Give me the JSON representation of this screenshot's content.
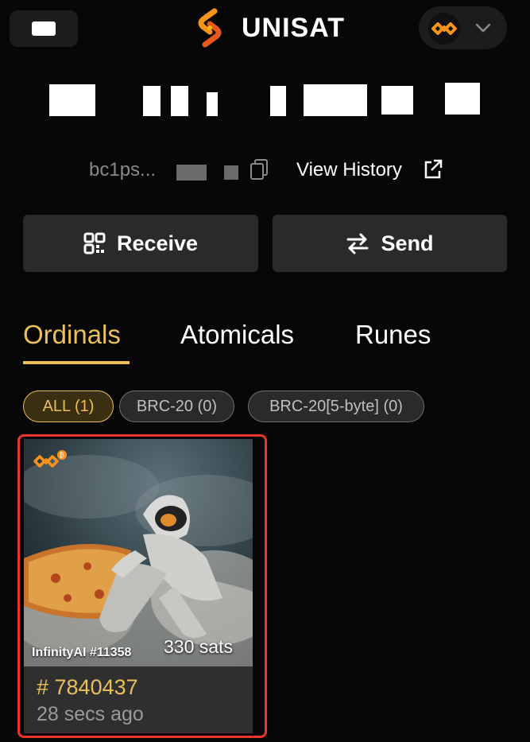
{
  "header": {
    "brand": "UNISAT",
    "menu_icon": "menu-icon",
    "logo_icon": "unisat-logo-icon",
    "account_icon": "chevron-down-icon"
  },
  "balance": {
    "redacted": true
  },
  "address": {
    "short": "bc1ps...",
    "copy_icon": "copy-icon"
  },
  "view_history": {
    "label": "View History",
    "icon": "external-link-icon"
  },
  "actions": {
    "receive_label": "Receive",
    "receive_icon": "qr-code-icon",
    "send_label": "Send",
    "send_icon": "swap-arrows-icon"
  },
  "tabs": [
    {
      "label": "Ordinals",
      "active": true
    },
    {
      "label": "Atomicals",
      "active": false
    },
    {
      "label": "Runes",
      "active": false
    }
  ],
  "filters": [
    {
      "label": "ALL (1)",
      "active": true
    },
    {
      "label": "BRC-20 (0)",
      "active": false
    },
    {
      "label": "BRC-20[5-byte] (0)",
      "active": false
    }
  ],
  "inscriptions": [
    {
      "name": "InfinityAI #11358",
      "price": "330 sats",
      "number": "# 7840437",
      "time": "28 secs ago",
      "badge_icon": "infinity-bitcoin-icon"
    }
  ],
  "colors": {
    "accent": "#e9c05b",
    "background": "#070707",
    "highlight": "#e8372a"
  }
}
